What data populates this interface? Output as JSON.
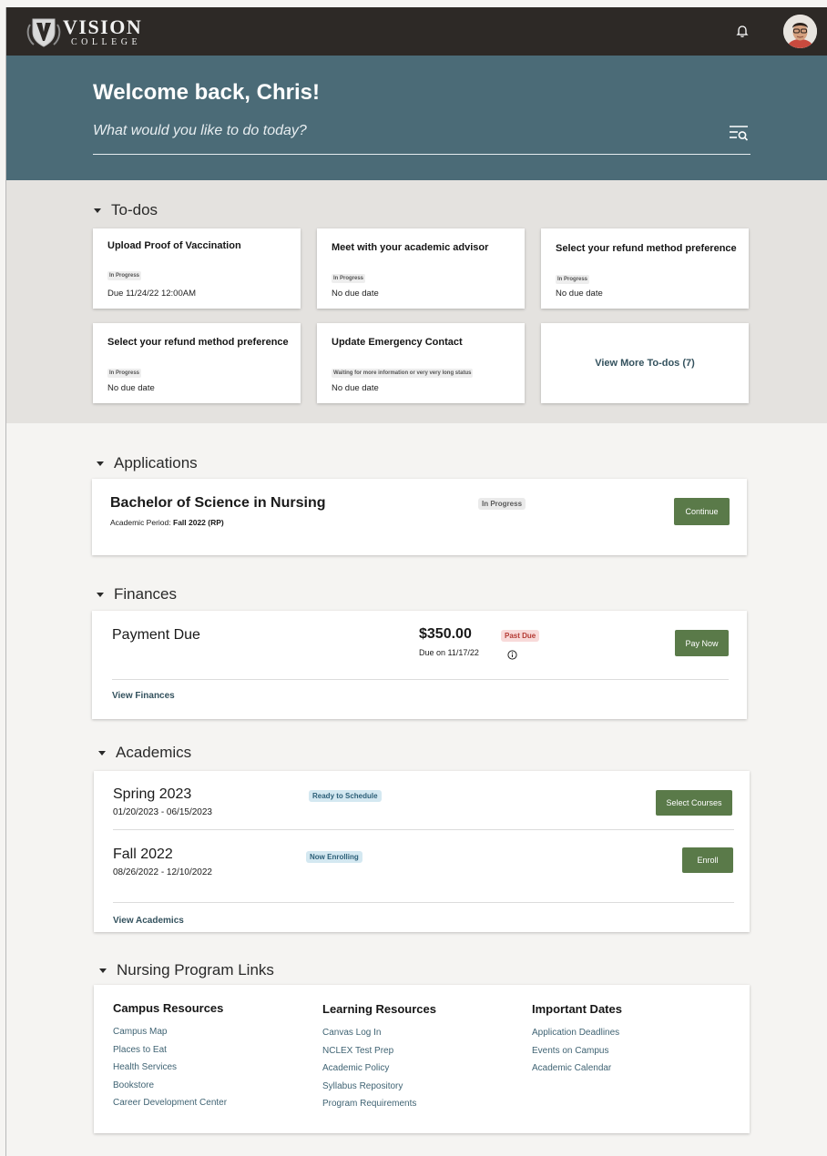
{
  "header": {
    "logo_main": "VISION",
    "logo_sub": "COLLEGE"
  },
  "hero": {
    "welcome": "Welcome back, Chris!",
    "search_placeholder": "What would you like to do today?"
  },
  "todos": {
    "title": "To-dos",
    "items": [
      {
        "title": "Upload Proof of Vaccination",
        "status": "In Progress",
        "due": "Due 11/24/22 12:00AM"
      },
      {
        "title": "Meet with your academic advisor",
        "status": "In Progress",
        "due": "No due date"
      },
      {
        "title": "Select your refund method preference",
        "status": "In Progress",
        "due": "No due date"
      },
      {
        "title": "Select your refund method preference",
        "status": "In Progress",
        "due": "No due date"
      },
      {
        "title": "Update Emergency Contact",
        "status": "Waiting for more information or very very long status",
        "due": "No due date"
      }
    ],
    "view_more": "View More To-dos (7)"
  },
  "applications": {
    "title": "Applications",
    "program": "Bachelor of Science in Nursing",
    "period_label": "Academic Period:",
    "period_value": "Fall 2022 (RP)",
    "status": "In Progress",
    "button": "Continue"
  },
  "finances": {
    "title": "Finances",
    "label": "Payment Due",
    "amount": "$350.00",
    "due": "Due on 11/17/22",
    "status": "Past Due",
    "button": "Pay Now",
    "link": "View Finances"
  },
  "academics": {
    "title": "Academics",
    "terms": [
      {
        "name": "Spring 2023",
        "dates": "01/20/2023 - 06/15/2023",
        "status": "Ready to Schedule",
        "button": "Select Courses"
      },
      {
        "name": "Fall 2022",
        "dates": "08/26/2022 - 12/10/2022",
        "status": "Now Enrolling",
        "button": "Enroll"
      }
    ],
    "link": "View Academics"
  },
  "links": {
    "title": "Nursing Program Links",
    "columns": [
      {
        "heading": "Campus Resources",
        "items": [
          "Campus Map",
          "Places to Eat",
          "Health Services",
          "Bookstore",
          "Career Development Center"
        ]
      },
      {
        "heading": "Learning Resources",
        "items": [
          "Canvas Log In",
          "NCLEX Test Prep",
          "Academic Policy",
          "Syllabus Repository",
          "Program Requirements"
        ]
      },
      {
        "heading": "Important Dates",
        "items": [
          "Application Deadlines",
          "Events on Campus",
          "Academic Calendar"
        ]
      }
    ]
  }
}
